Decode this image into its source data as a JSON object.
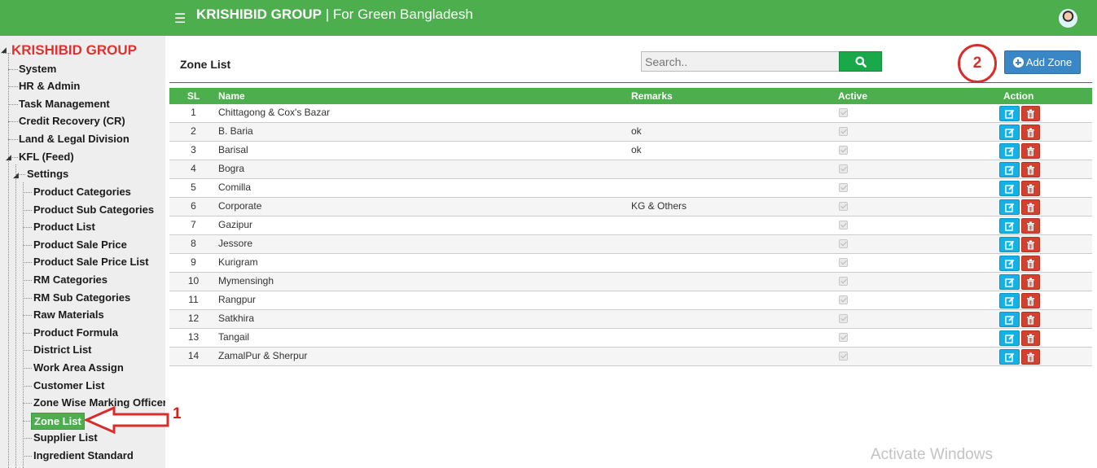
{
  "header": {
    "brand": "KRISHIBID GROUP",
    "separator": " | ",
    "tagline": "For Green Bangladesh",
    "menu_icon": "hamburger-icon",
    "avatar_icon": "user-avatar-icon"
  },
  "sidebar": {
    "root": "KRISHIBID GROUP",
    "items": [
      {
        "label": "System"
      },
      {
        "label": "HR & Admin"
      },
      {
        "label": "Task Management"
      },
      {
        "label": "Credit Recovery (CR)"
      },
      {
        "label": "Land & Legal Division"
      },
      {
        "label": "KFL (Feed)"
      }
    ],
    "settings_label": "Settings",
    "settings_items": [
      {
        "label": "Product Categories"
      },
      {
        "label": "Product Sub Categories"
      },
      {
        "label": "Product List"
      },
      {
        "label": "Product Sale Price"
      },
      {
        "label": "Product Sale Price List"
      },
      {
        "label": "RM Categories"
      },
      {
        "label": "RM Sub Categories"
      },
      {
        "label": "Raw Materials"
      },
      {
        "label": "Product Formula"
      },
      {
        "label": "District List"
      },
      {
        "label": "Work Area Assign"
      },
      {
        "label": "Customer List"
      },
      {
        "label": "Zone Wise Marking Officer"
      },
      {
        "label": "Zone List",
        "active": true
      },
      {
        "label": "Supplier List"
      },
      {
        "label": "Ingredient Standard"
      }
    ]
  },
  "annotations": {
    "step1": "1",
    "step2": "2"
  },
  "main": {
    "title": "Zone List",
    "search_placeholder": "Search..",
    "search_icon": "search-icon",
    "add_button": "Add Zone",
    "add_icon": "plus-circle-icon"
  },
  "table": {
    "headers": {
      "sl": "SL",
      "name": "Name",
      "remarks": "Remarks",
      "active": "Active",
      "action": "Action"
    },
    "rows": [
      {
        "sl": "1",
        "name": "Chittagong & Cox's Bazar",
        "remarks": "",
        "active": true
      },
      {
        "sl": "2",
        "name": "B. Baria",
        "remarks": "ok",
        "active": true
      },
      {
        "sl": "3",
        "name": "Barisal",
        "remarks": "ok",
        "active": true
      },
      {
        "sl": "4",
        "name": "Bogra",
        "remarks": "",
        "active": true
      },
      {
        "sl": "5",
        "name": "Comilla",
        "remarks": "",
        "active": true
      },
      {
        "sl": "6",
        "name": "Corporate",
        "remarks": "KG & Others",
        "active": true
      },
      {
        "sl": "7",
        "name": "Gazipur",
        "remarks": "",
        "active": true
      },
      {
        "sl": "8",
        "name": "Jessore",
        "remarks": "",
        "active": true
      },
      {
        "sl": "9",
        "name": "Kurigram",
        "remarks": "",
        "active": true
      },
      {
        "sl": "10",
        "name": "Mymensingh",
        "remarks": "",
        "active": true
      },
      {
        "sl": "11",
        "name": "Rangpur",
        "remarks": "",
        "active": true
      },
      {
        "sl": "12",
        "name": "Satkhira",
        "remarks": "",
        "active": true
      },
      {
        "sl": "13",
        "name": "Tangail",
        "remarks": "",
        "active": true
      },
      {
        "sl": "14",
        "name": "ZamalPur & Sherpur",
        "remarks": "",
        "active": true
      }
    ]
  },
  "watermark": "Activate Windows",
  "colors": {
    "header_green": "#4cae4c",
    "brand_red": "#e03131",
    "edit_blue": "#14b1e4",
    "delete_red": "#d2412f",
    "add_blue": "#3a87c7"
  }
}
